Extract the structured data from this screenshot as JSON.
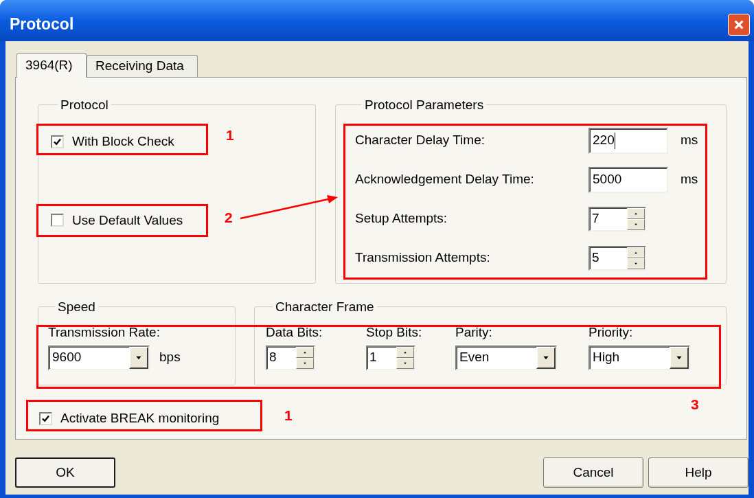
{
  "window": {
    "title": "Protocol"
  },
  "tabs": [
    {
      "label": "3964(R)",
      "selected": true
    },
    {
      "label": "Receiving Data",
      "selected": false
    }
  ],
  "protocol_group": {
    "title": "Protocol",
    "options": [
      {
        "label": "With Block Check",
        "checked": true
      },
      {
        "label": "Use Default Values",
        "checked": false
      }
    ]
  },
  "parameters_group": {
    "title": "Protocol Parameters",
    "fields": [
      {
        "kind": "text",
        "label": "Character Delay Time:",
        "value": "220",
        "unit": "ms",
        "focused": true
      },
      {
        "kind": "text",
        "label": "Acknowledgement Delay Time:",
        "value": "5000",
        "unit": "ms",
        "focused": false
      },
      {
        "kind": "spin",
        "label": "Setup Attempts:",
        "value": "7"
      },
      {
        "kind": "spin",
        "label": "Transmission Attempts:",
        "value": "5"
      }
    ]
  },
  "speed_group": {
    "title": "Speed",
    "label": "Transmission Rate:",
    "value": "9600",
    "unit": "bps"
  },
  "frame_group": {
    "title": "Character Frame",
    "fields": [
      {
        "kind": "spin",
        "label": "Data Bits:",
        "value": "8"
      },
      {
        "kind": "spin",
        "label": "Stop Bits:",
        "value": "1"
      },
      {
        "kind": "dropdown",
        "label": "Parity:",
        "value": "Even"
      },
      {
        "kind": "dropdown",
        "label": "Priority:",
        "value": "High"
      }
    ]
  },
  "break_monitoring": {
    "label": "Activate BREAK monitoring",
    "checked": true
  },
  "buttons": [
    {
      "label": "OK",
      "default": true
    },
    {
      "label": "Cancel",
      "default": false
    },
    {
      "label": "Help",
      "default": false
    }
  ],
  "annotations": [
    {
      "number": "1"
    },
    {
      "number": "2"
    },
    {
      "number": "1"
    },
    {
      "number": "3"
    }
  ]
}
